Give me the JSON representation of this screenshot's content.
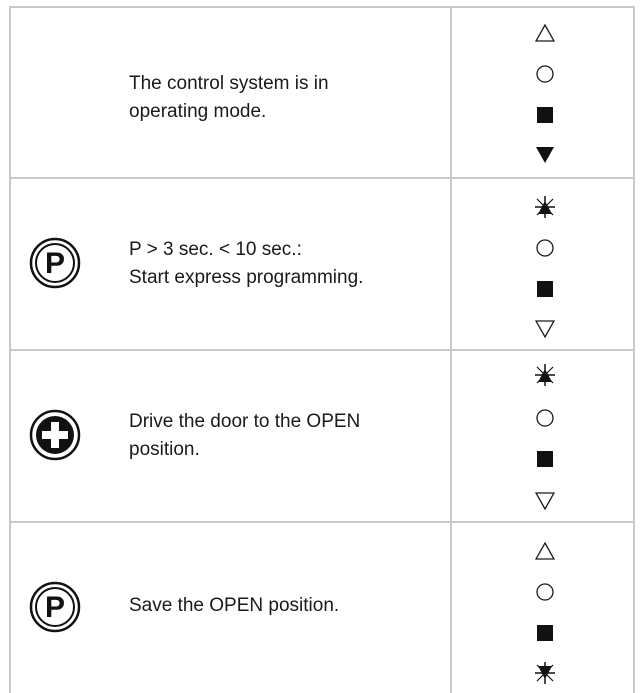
{
  "rows": [
    {
      "icon": "",
      "text": "The control system is in operating mode.",
      "lines": [
        "The control system is in",
        "operating mode."
      ],
      "indicators": [
        "triangle-up-outline",
        "circle-outline",
        "square-filled",
        "triangle-down-filled"
      ]
    },
    {
      "icon": "p-button-icon",
      "text_lines": [
        "P > 3 sec. < 10 sec.:",
        "Start express programming."
      ],
      "indicators": [
        "triangle-up-flashing",
        "circle-outline",
        "square-filled",
        "triangle-down-outline"
      ]
    },
    {
      "icon": "plus-button-icon",
      "text_lines": [
        "Drive the door to the OPEN",
        "position."
      ],
      "indicators": [
        "triangle-up-flashing",
        "circle-outline",
        "square-filled",
        "triangle-down-outline"
      ]
    },
    {
      "icon": "p-button-icon",
      "text_lines": [
        "Save the OPEN position."
      ],
      "indicators": [
        "triangle-up-outline",
        "circle-outline",
        "square-filled",
        "triangle-down-flashing"
      ]
    }
  ],
  "icons": {
    "p_label": "P"
  }
}
